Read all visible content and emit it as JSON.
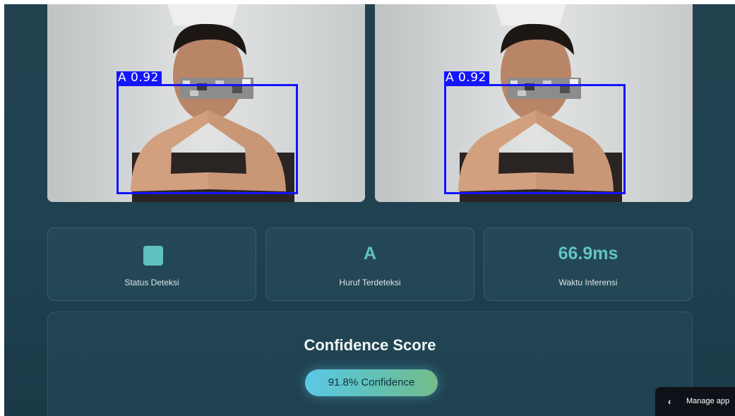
{
  "camera_left": {
    "detection_label": "A 0.92"
  },
  "camera_right": {
    "detection_label": "A 0.92"
  },
  "stats": {
    "status": {
      "label": "Status Deteksi",
      "indicator_color": "#5ec3c0"
    },
    "letter": {
      "value": "A",
      "label": "Huruf Terdeteksi"
    },
    "inference": {
      "value": "66.9ms",
      "label": "Waktu Inferensi"
    }
  },
  "confidence": {
    "title": "Confidence Score",
    "badge": "91.8% Confidence",
    "value_percent": 91.8
  },
  "footer": {
    "manage_app_label": "Manage app"
  },
  "colors": {
    "accent": "#63c2c2",
    "detection_box": "#1414ff",
    "background": "#1f4150"
  }
}
